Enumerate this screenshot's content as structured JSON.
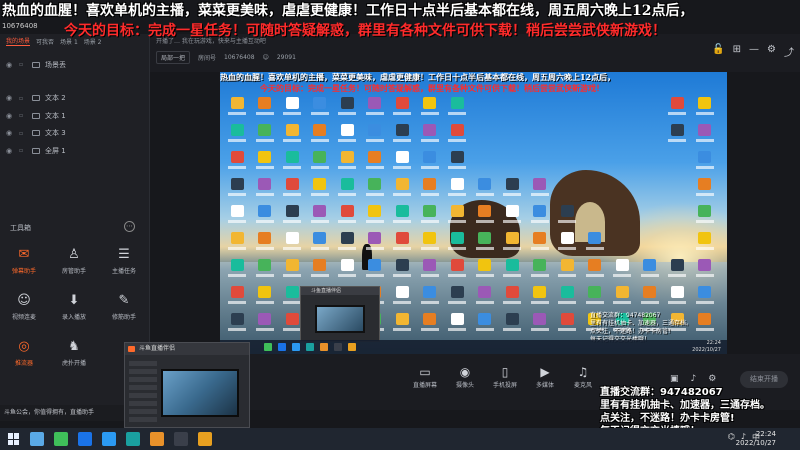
{
  "overlay": {
    "marquee_top": "热血的血腥！喜欢单机的主播，菜菜更美味，虐虐更健康！工作日十点半后基本都在线，周五周六晚上12点后，",
    "marquee_goal": "今天的目标：完成一星任务！可随时答疑解惑，群里有各种文件可供下载！稍后尝尝武侠新游戏！",
    "room_id": "10676408",
    "info_lines": [
      "直播交流群：947482067",
      "里有有挂机抽卡、加速器，三通存档。",
      "点关注，不迷路！办卡卡房管!",
      "每天记得交交光棒哦！"
    ]
  },
  "left_panel": {
    "tabs": [
      "我的场景",
      "可我否",
      "场景 1",
      "场景 2"
    ],
    "active_tab": 0,
    "layers": [
      "场景丢",
      "文本 2",
      "文本 1",
      "文本 3",
      "全屏 1"
    ],
    "tools_title": "工具箱",
    "tools": [
      {
        "label": "弹幕助手",
        "icon": "✉",
        "orange": true
      },
      {
        "label": "房管助手",
        "icon": "♙",
        "orange": false
      },
      {
        "label": "主播任务",
        "icon": "☰",
        "orange": false
      },
      {
        "label": "视频连麦",
        "icon": "☺",
        "orange": false
      },
      {
        "label": "录入播放",
        "icon": "⬇",
        "orange": false
      },
      {
        "label": "修筋助手",
        "icon": "✎",
        "orange": false
      },
      {
        "label": "推流器",
        "icon": "◎",
        "orange": true
      },
      {
        "label": "虎扑开播",
        "icon": "♞",
        "orange": false
      }
    ],
    "announcement": "斗鱼公会，你值得拥有，直播助手"
  },
  "header": {
    "row1": "开播了… 我在玩游戏，快来与主播互动吧",
    "room_label": "房间号",
    "room_id": "10676408",
    "viewers": "29091",
    "edit_button": "局部一把"
  },
  "preview": {
    "taskbar_time": "22:24",
    "taskbar_date": "2022/10/27",
    "popup_title": "斗鱼直播伴侣",
    "info_lines": [
      "直播交流群：947482067",
      "里有有挂机抽卡、加速器，三通存档。",
      "点关注，不迷路！办卡卡房管!",
      "每天记得交交光棒哦！"
    ]
  },
  "controls": {
    "buttons": [
      {
        "label": "直播屏幕",
        "icon": "▭"
      },
      {
        "label": "摄像头",
        "icon": "◉"
      },
      {
        "label": "手机投屏",
        "icon": "▯"
      },
      {
        "label": "多媒体",
        "icon": "▶"
      },
      {
        "label": "麦克风",
        "icon": "♫"
      }
    ],
    "start_live": "结束开播"
  },
  "float_window": {
    "title": "斗鱼直播伴侣"
  },
  "taskbar": {
    "time": "22:24",
    "date": "2022/10/27",
    "apps": [
      "#5aa9e6",
      "#3fbf5a",
      "#1a73e8",
      "#2b9af3",
      "#1aa0a0",
      "#e8912a",
      "#3a3f4a",
      "#e8a020"
    ]
  }
}
